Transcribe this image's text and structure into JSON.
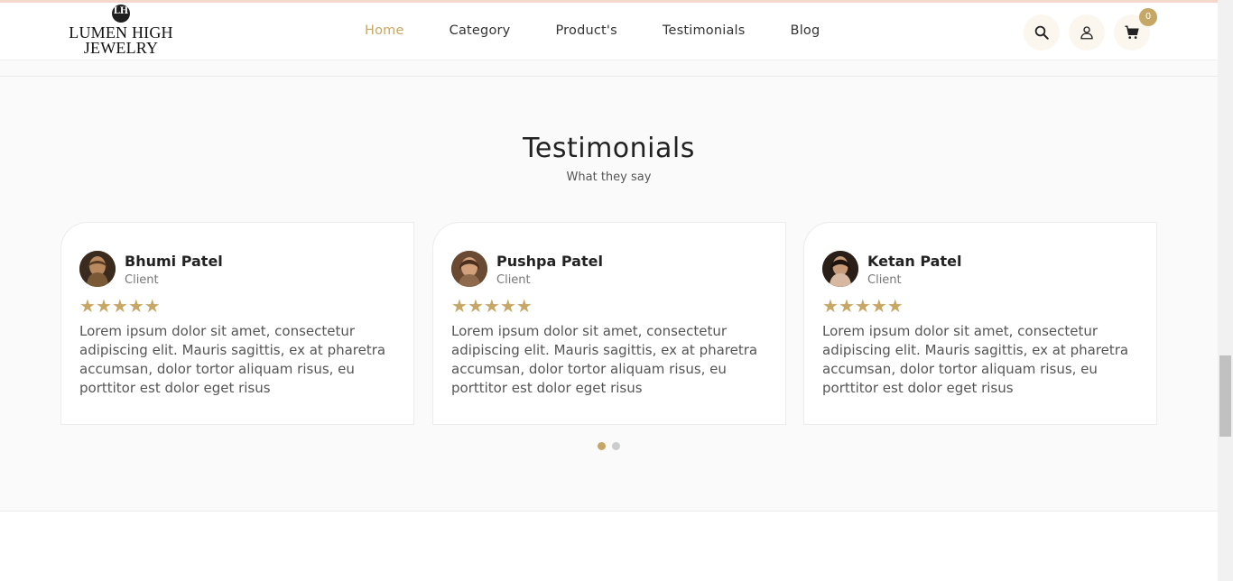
{
  "brand": {
    "mark": "LH",
    "name_line1": "LUMEN HIGH",
    "name_line2": "JEWELRY"
  },
  "nav": {
    "items": [
      {
        "label": "Home",
        "active": true
      },
      {
        "label": "Category",
        "active": false
      },
      {
        "label": "Product's",
        "active": false
      },
      {
        "label": "Testimonials",
        "active": false
      },
      {
        "label": "Blog",
        "active": false
      }
    ]
  },
  "header_actions": {
    "search_icon": "search-icon",
    "account_icon": "user-icon",
    "cart_icon": "cart-icon",
    "cart_count": "0"
  },
  "testimonials": {
    "title": "Testimonials",
    "subtitle": "What they say",
    "cards": [
      {
        "name": "Bhumi Patel",
        "role": "Client",
        "rating": 5,
        "text": "Lorem ipsum dolor sit amet, consectetur adipiscing elit. Mauris sagittis, ex at pharetra accumsan, dolor tortor aliquam risus, eu porttitor est dolor eget risus"
      },
      {
        "name": "Pushpa Patel",
        "role": "Client",
        "rating": 5,
        "text": "Lorem ipsum dolor sit amet, consectetur adipiscing elit. Mauris sagittis, ex at pharetra accumsan, dolor tortor aliquam risus, eu porttitor est dolor eget risus"
      },
      {
        "name": "Ketan Patel",
        "role": "Client",
        "rating": 5,
        "text": "Lorem ipsum dolor sit amet, consectetur adipiscing elit. Mauris sagittis, ex at pharetra accumsan, dolor tortor aliquam risus, eu porttitor est dolor eget risus"
      }
    ],
    "pagination": {
      "pages": 2,
      "current": 1
    }
  },
  "colors": {
    "accent": "#c7a765",
    "icon_bg": "#fbf7ee",
    "section_bg": "#fafafa"
  }
}
